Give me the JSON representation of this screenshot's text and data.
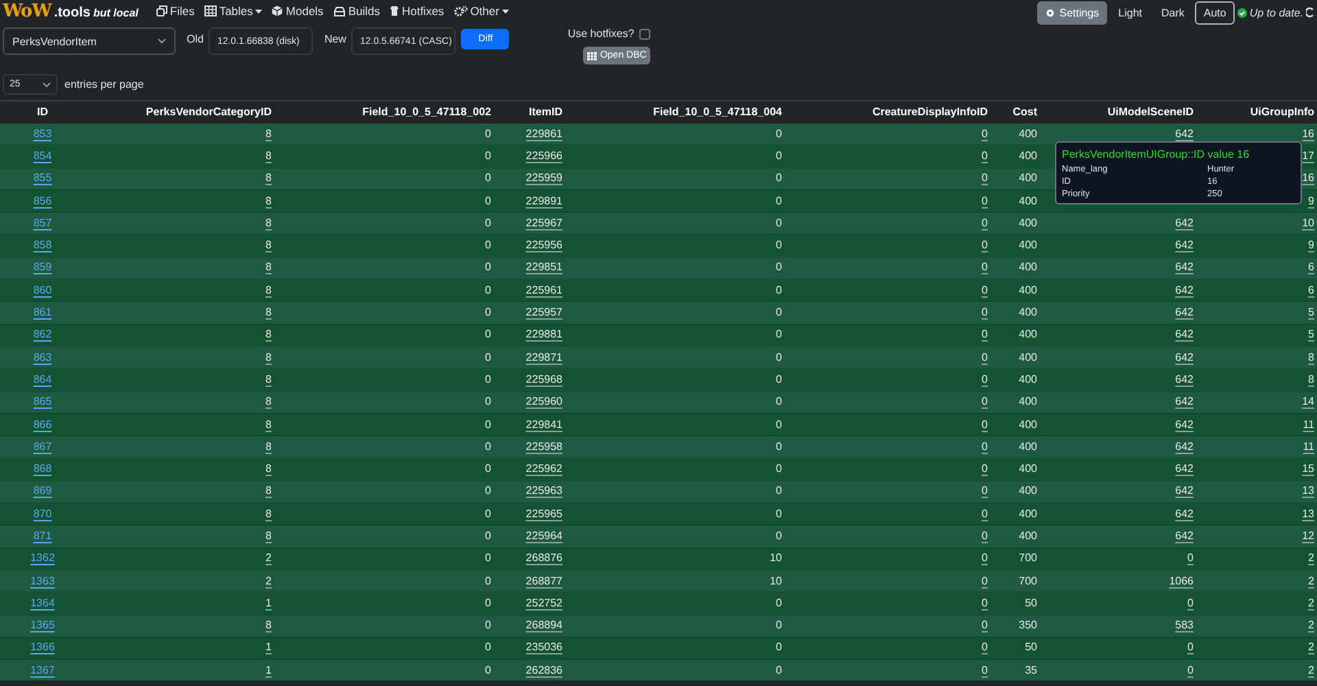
{
  "logo": {
    "brand": "WoW",
    "suffix": ".tools",
    "tagline": "but local"
  },
  "nav": [
    {
      "label": "Files",
      "dropdown": false
    },
    {
      "label": "Tables",
      "dropdown": true
    },
    {
      "label": "Models",
      "dropdown": false
    },
    {
      "label": "Builds",
      "dropdown": false
    },
    {
      "label": "Hotfixes",
      "dropdown": false
    },
    {
      "label": "Other",
      "dropdown": true
    }
  ],
  "settings_button": "Settings",
  "themes": [
    {
      "label": "Light",
      "selected": false
    },
    {
      "label": "Dark",
      "selected": false
    },
    {
      "label": "Auto",
      "selected": true
    }
  ],
  "status": "Up to date.",
  "table_select": "PerksVendorItem",
  "old": {
    "label": "Old",
    "value": "12.0.1.66838 (disk)"
  },
  "new": {
    "label": "New",
    "value": "12.0.5.66741 (CASC)"
  },
  "diff_button": "Diff",
  "hotfixes": {
    "label": "Use hotfixes?",
    "checked": false
  },
  "open_button": "Open DBC",
  "page_size": {
    "value": "25",
    "label": "entries per page"
  },
  "table": {
    "columns": [
      {
        "label": "ID",
        "kind": "id"
      },
      {
        "label": "PerksVendorCategoryID",
        "kind": "fk"
      },
      {
        "label": "Field_10_0_5_47118_002",
        "kind": "plain"
      },
      {
        "label": "ItemID",
        "kind": "fk"
      },
      {
        "label": "Field_10_0_5_47118_004",
        "kind": "plain"
      },
      {
        "label": "CreatureDisplayInfoID",
        "kind": "fk"
      },
      {
        "label": "Cost",
        "kind": "plain"
      },
      {
        "label": "UiModelSceneID",
        "kind": "fk"
      },
      {
        "label": "UiGroupInfo",
        "kind": "fk"
      }
    ],
    "rows": [
      [
        "853",
        "8",
        "0",
        "229861",
        "0",
        "0",
        "400",
        "642",
        "16"
      ],
      [
        "854",
        "8",
        "0",
        "225966",
        "0",
        "0",
        "400",
        null,
        "17"
      ],
      [
        "855",
        "8",
        "0",
        "225959",
        "0",
        "0",
        "400",
        null,
        "16"
      ],
      [
        "856",
        "8",
        "0",
        "229891",
        "0",
        "0",
        "400",
        null,
        "9"
      ],
      [
        "857",
        "8",
        "0",
        "225967",
        "0",
        "0",
        "400",
        "642",
        "10"
      ],
      [
        "858",
        "8",
        "0",
        "225956",
        "0",
        "0",
        "400",
        "642",
        "9"
      ],
      [
        "859",
        "8",
        "0",
        "229851",
        "0",
        "0",
        "400",
        "642",
        "6"
      ],
      [
        "860",
        "8",
        "0",
        "225961",
        "0",
        "0",
        "400",
        "642",
        "6"
      ],
      [
        "861",
        "8",
        "0",
        "225957",
        "0",
        "0",
        "400",
        "642",
        "5"
      ],
      [
        "862",
        "8",
        "0",
        "229881",
        "0",
        "0",
        "400",
        "642",
        "5"
      ],
      [
        "863",
        "8",
        "0",
        "229871",
        "0",
        "0",
        "400",
        "642",
        "8"
      ],
      [
        "864",
        "8",
        "0",
        "225968",
        "0",
        "0",
        "400",
        "642",
        "8"
      ],
      [
        "865",
        "8",
        "0",
        "225960",
        "0",
        "0",
        "400",
        "642",
        "14"
      ],
      [
        "866",
        "8",
        "0",
        "229841",
        "0",
        "0",
        "400",
        "642",
        "11"
      ],
      [
        "867",
        "8",
        "0",
        "225958",
        "0",
        "0",
        "400",
        "642",
        "11"
      ],
      [
        "868",
        "8",
        "0",
        "225962",
        "0",
        "0",
        "400",
        "642",
        "15"
      ],
      [
        "869",
        "8",
        "0",
        "225963",
        "0",
        "0",
        "400",
        "642",
        "13"
      ],
      [
        "870",
        "8",
        "0",
        "225965",
        "0",
        "0",
        "400",
        "642",
        "13"
      ],
      [
        "871",
        "8",
        "0",
        "225964",
        "0",
        "0",
        "400",
        "642",
        "12"
      ],
      [
        "1362",
        "2",
        "0",
        "268876",
        "10",
        "0",
        "700",
        "0",
        "2"
      ],
      [
        "1363",
        "2",
        "0",
        "268877",
        "10",
        "0",
        "700",
        "1066",
        "2"
      ],
      [
        "1364",
        "1",
        "0",
        "252752",
        "0",
        "0",
        "50",
        "0",
        "2"
      ],
      [
        "1365",
        "8",
        "0",
        "268894",
        "0",
        "0",
        "350",
        "583",
        "2"
      ],
      [
        "1366",
        "1",
        "0",
        "235036",
        "0",
        "0",
        "50",
        "0",
        "2"
      ],
      [
        "1367",
        "1",
        "0",
        "262836",
        "0",
        "0",
        "35",
        "0",
        "2"
      ]
    ]
  },
  "tooltip": {
    "title": "PerksVendorItemUIGroup::ID value 16",
    "fields": [
      {
        "label": "Name_lang",
        "value": "Hunter"
      },
      {
        "label": "ID",
        "value": "16"
      },
      {
        "label": "Priority",
        "value": "250"
      }
    ]
  }
}
